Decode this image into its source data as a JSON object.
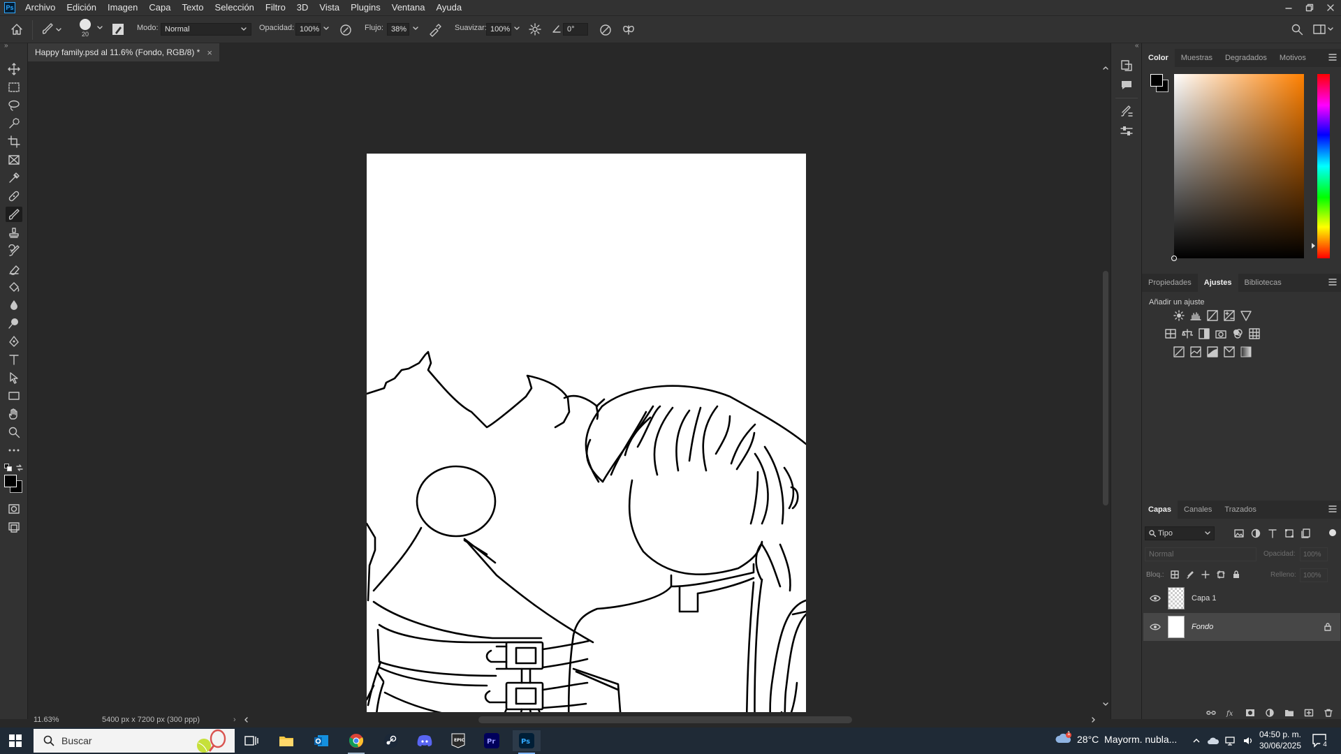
{
  "menubar": {
    "logo": "Ps",
    "items": [
      "Archivo",
      "Edición",
      "Imagen",
      "Capa",
      "Texto",
      "Selección",
      "Filtro",
      "3D",
      "Vista",
      "Plugins",
      "Ventana",
      "Ayuda"
    ]
  },
  "options": {
    "brush_size": "20",
    "mode_label": "Modo:",
    "mode_value": "Normal",
    "opacity_label": "Opacidad:",
    "opacity_value": "100%",
    "flow_label": "Flujo:",
    "flow_value": "38%",
    "smooth_label": "Suavizar:",
    "smooth_value": "100%",
    "angle_value": "0°"
  },
  "document": {
    "tab_title": "Happy family.psd al 11.6% (Fondo, RGB/8) *",
    "close": "×"
  },
  "status": {
    "zoom": "11.63%",
    "doc_info": "5400 px x 7200 px (300 ppp)",
    "arrow": "›"
  },
  "color_panel": {
    "tabs": [
      "Color",
      "Muestras",
      "Degradados",
      "Motivos"
    ],
    "foreground": "#000000",
    "background": "#000000",
    "hue_color": "#ff8000"
  },
  "props_panel": {
    "tabs": [
      "Propiedades",
      "Ajustes",
      "Bibliotecas"
    ],
    "add_adjustment": "Añadir un ajuste"
  },
  "layers_panel": {
    "tabs": [
      "Capas",
      "Canales",
      "Trazados"
    ],
    "filter_kind": "Tipo",
    "blend_mode": "Normal",
    "opacity_label": "Opacidad:",
    "opacity_value": "100%",
    "lock_label": "Bloq.:",
    "fill_label": "Relleno:",
    "fill_value": "100%",
    "layers": [
      {
        "name": "Capa 1",
        "visible": true,
        "locked": false,
        "selected": false
      },
      {
        "name": "Fondo",
        "visible": true,
        "locked": true,
        "selected": true
      }
    ]
  },
  "taskbar": {
    "search_placeholder": "Buscar",
    "weather": "28°C  Mayorm. nubla...",
    "time": "04:50 p. m.",
    "date": "30/06/2025",
    "notifications": "4",
    "badge": "1"
  }
}
